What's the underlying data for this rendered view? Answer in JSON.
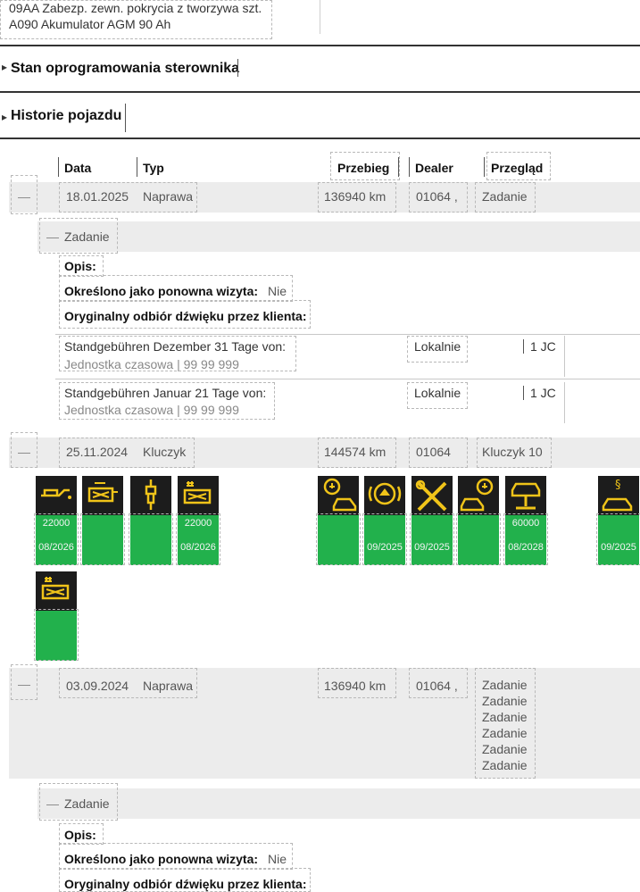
{
  "battery": {
    "line1": "09AA Zabezp. zewn. pokrycia z tworzywa szt.",
    "line2": "A090 Akumulator AGM 90 Ah"
  },
  "sections": {
    "software": "Stan oprogramowania sterownika",
    "history": "Historie pojazdu"
  },
  "table": {
    "headers": {
      "date": "Data",
      "type": "Typ",
      "mileage": "Przebieg",
      "dealer": "Dealer",
      "inspection": "Przegląd"
    }
  },
  "entries": [
    {
      "toggle": "—",
      "date": "18.01.2025",
      "type": "Naprawa",
      "mileage": "136940 km",
      "dealer": "01064 ,",
      "inspection": "Zadanie",
      "task": {
        "toggle": "—",
        "label": "Zadanie",
        "opis_label": "Opis:",
        "revisit_label": "Określono jako ponowna wizyta:",
        "revisit_value": "Nie",
        "sound_label": "Oryginalny odbiór dźwięku przez klienta:",
        "items": [
          {
            "title": "Standgebühren Dezember 31 Tage von:",
            "sub": "Jednostka czasowa | 99 99 999",
            "loc": "Lokalnie",
            "qty": "1 JC"
          },
          {
            "title": "Standgebühren Januar 21 Tage von:",
            "sub": "Jednostka czasowa | 99 99 999",
            "loc": "Lokalnie",
            "qty": "1 JC"
          }
        ]
      }
    },
    {
      "toggle": "—",
      "date": "25.11.2024",
      "type": "Kluczyk",
      "mileage": "144574 km",
      "dealer": "01064",
      "inspection": "Kluczyk 10"
    },
    {
      "toggle": "—",
      "date": "03.09.2024",
      "type": "Naprawa",
      "mileage": "136940 km",
      "dealer": "01064 ,",
      "inspection_list": [
        "Zadanie",
        "Zadanie",
        "Zadanie",
        "Zadanie",
        "Zadanie",
        "Zadanie"
      ],
      "task": {
        "toggle": "—",
        "label": "Zadanie",
        "opis_label": "Opis:",
        "revisit_label": "Określono jako ponowna wizyta:",
        "revisit_value": "Nie",
        "sound_label": "Oryginalny odbiór dźwięku przez klienta:"
      }
    }
  ],
  "service_tiles": [
    {
      "icon": "oil-can-icon",
      "top": "22000",
      "bottom": "08/2026"
    },
    {
      "icon": "engine-filter-icon",
      "top": "",
      "bottom": ""
    },
    {
      "icon": "spark-plug-icon",
      "top": "",
      "bottom": ""
    },
    {
      "icon": "microfilter-icon",
      "top": "22000",
      "bottom": "08/2026"
    },
    {
      "icon": "vehicle-check-icon",
      "top": "",
      "bottom": ""
    },
    {
      "icon": "brake-fluid-icon",
      "top": "",
      "bottom": "09/2025"
    },
    {
      "icon": "tools-icon",
      "top": "",
      "bottom": "09/2025"
    },
    {
      "icon": "vehicle-check-rear-icon",
      "top": "",
      "bottom": ""
    },
    {
      "icon": "car-lift-icon",
      "top": "60000",
      "bottom": "08/2028"
    },
    {
      "icon": "legal-inspection-icon",
      "top": "",
      "bottom": "09/2025"
    },
    {
      "icon": "microfilter-icon",
      "top": "",
      "bottom": ""
    }
  ],
  "colors": {
    "tile_dark": "#1c1c1c",
    "tile_green": "#22b14c",
    "icon_yellow": "#f0c419",
    "row_grey": "#ececec"
  }
}
